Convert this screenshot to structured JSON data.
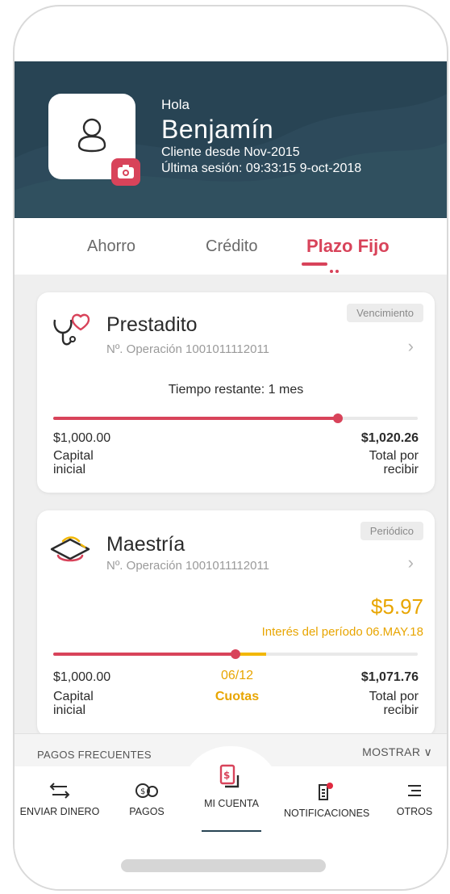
{
  "header": {
    "greeting": "Hola",
    "name": "Benjamín",
    "client_since": "Cliente desde Nov-2015",
    "last_session": "Última sesión: 09:33:15 9-oct-2018"
  },
  "tabs": [
    {
      "label": "Ahorro",
      "active": false
    },
    {
      "label": "Crédito",
      "active": false
    },
    {
      "label": "Plazo Fijo",
      "active": true
    }
  ],
  "cards": [
    {
      "badge": "Vencimiento",
      "title": "Prestadito",
      "operation": "Nº. Operación 1001011112011",
      "remaining": "Tiempo restante: 1 mes",
      "progress": 0.78,
      "start_amount": "$1,000.00",
      "start_label": "Capital inicial",
      "end_amount": "$1,020.26",
      "end_label": "Total por recibir",
      "icon": "stethoscope-heart-icon"
    },
    {
      "badge": "Periódico",
      "title": "Maestría",
      "operation": "Nº. Operación 1001011112011",
      "interest_amount": "$5.97",
      "interest_label": "Interés del período 06.MAY.18",
      "progress": 0.5,
      "start_amount": "$1,000.00",
      "start_label": "Capital inicial",
      "cuotas_value": "06/12",
      "cuotas_label": "Cuotas",
      "end_amount": "$1,071.76",
      "end_label": "Total por recibir",
      "icon": "graduation-cap-icon"
    }
  ],
  "frequent": {
    "label": "PAGOS FRECUENTES",
    "toggle": "MOSTRAR"
  },
  "bottom_nav": [
    {
      "label": "ENVIAR DINERO",
      "icon": "transfer-arrows-icon"
    },
    {
      "label": "PAGOS",
      "icon": "coins-icon"
    },
    {
      "label": "MI CUENTA",
      "icon": "account-phone-icon",
      "active": true
    },
    {
      "label": "NOTIFICACIONES",
      "icon": "notifications-doc-icon"
    },
    {
      "label": "OTROS",
      "icon": "menu-lines-icon"
    }
  ],
  "colors": {
    "accent": "#d8435a",
    "header_bg": "#284454",
    "highlight": "#e8a500"
  }
}
